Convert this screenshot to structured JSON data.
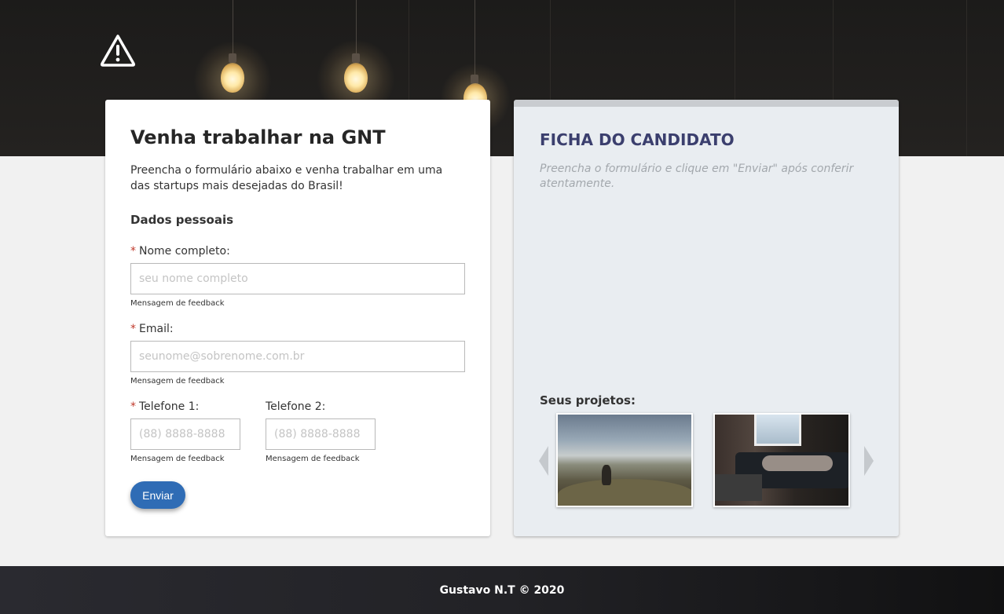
{
  "header": {
    "logo_icon": "warning-triangle-icon"
  },
  "form": {
    "title": "Venha trabalhar na GNT",
    "intro": "Preencha o formulário abaixo e venha trabalhar em uma das startups mais desejadas do Brasil!",
    "section_title": "Dados pessoais",
    "required_mark": "*",
    "name": {
      "label": "Nome completo:",
      "placeholder": "seu nome completo",
      "feedback": "Mensagem de feedback"
    },
    "email": {
      "label": "Email:",
      "placeholder": "seunome@sobrenome.com.br",
      "feedback": "Mensagem de feedback"
    },
    "phone1": {
      "label": "Telefone 1:",
      "placeholder": "(88) 8888-8888",
      "feedback": "Mensagem de feedback"
    },
    "phone2": {
      "label": "Telefone 2:",
      "placeholder": "(88) 8888-8888",
      "feedback": "Mensagem de feedback"
    },
    "submit_label": "Enviar"
  },
  "candidate": {
    "title": "FICHA DO CANDIDATO",
    "hint": "Preencha o formulário e clique em \"Enviar\" após conferir atentamente.",
    "projects_title": "Seus projetos:",
    "carousel_prev_icon": "chevron-left-icon",
    "carousel_next_icon": "chevron-right-icon"
  },
  "footer": {
    "text": "Gustavo N.T © 2020"
  },
  "colors": {
    "primary_button": "#2f6cb5",
    "title_accent": "#3b3f6e",
    "required": "#c0392b"
  }
}
